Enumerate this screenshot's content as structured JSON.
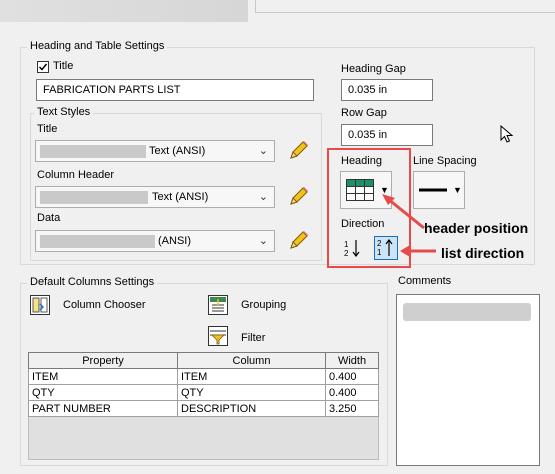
{
  "heading_table": {
    "group_title": "Heading and Table Settings",
    "title_checkbox": {
      "label": "Title",
      "checked": true
    },
    "title_value": "FABRICATION PARTS LIST",
    "text_styles": {
      "group_title": "Text Styles",
      "title_label": "Title",
      "title_value": "Text (ANSI)",
      "column_header_label": "Column Header",
      "column_header_value": "Text (ANSI)",
      "data_label": "Data",
      "data_value": "(ANSI)"
    },
    "heading_gap_label": "Heading Gap",
    "heading_gap_value": "0.035 in",
    "row_gap_label": "Row Gap",
    "row_gap_value": "0.035 in",
    "heading_label": "Heading",
    "line_spacing_label": "Line Spacing",
    "direction_label": "Direction"
  },
  "annotations": {
    "header_position": "header position",
    "list_direction": "list direction",
    "color": "#e84a4a"
  },
  "default_columns": {
    "group_title": "Default Columns Settings",
    "column_chooser_label": "Column Chooser",
    "grouping_label": "Grouping",
    "filter_label": "Filter",
    "table_headers": [
      "Property",
      "Column",
      "Width"
    ],
    "rows": [
      [
        "ITEM",
        "ITEM",
        "0.400"
      ],
      [
        "QTY",
        "QTY",
        "0.400"
      ],
      [
        "PART NUMBER",
        "DESCRIPTION",
        "3.250"
      ]
    ]
  },
  "comments": {
    "label": "Comments"
  },
  "icons": {
    "pencil": "pencil-icon",
    "heading_grid": "grid-heading-icon",
    "line_spacing": "line-spacing-icon",
    "direction_down": "sort-down-icon",
    "direction_up": "sort-up-icon",
    "column_chooser": "column-chooser-icon",
    "grouping": "grouping-icon",
    "filter": "filter-icon",
    "cursor": "mouse-pointer-icon"
  },
  "colors": {
    "accent": "#1a6fb8",
    "heading_grid_fill": "#1c8f6a"
  }
}
